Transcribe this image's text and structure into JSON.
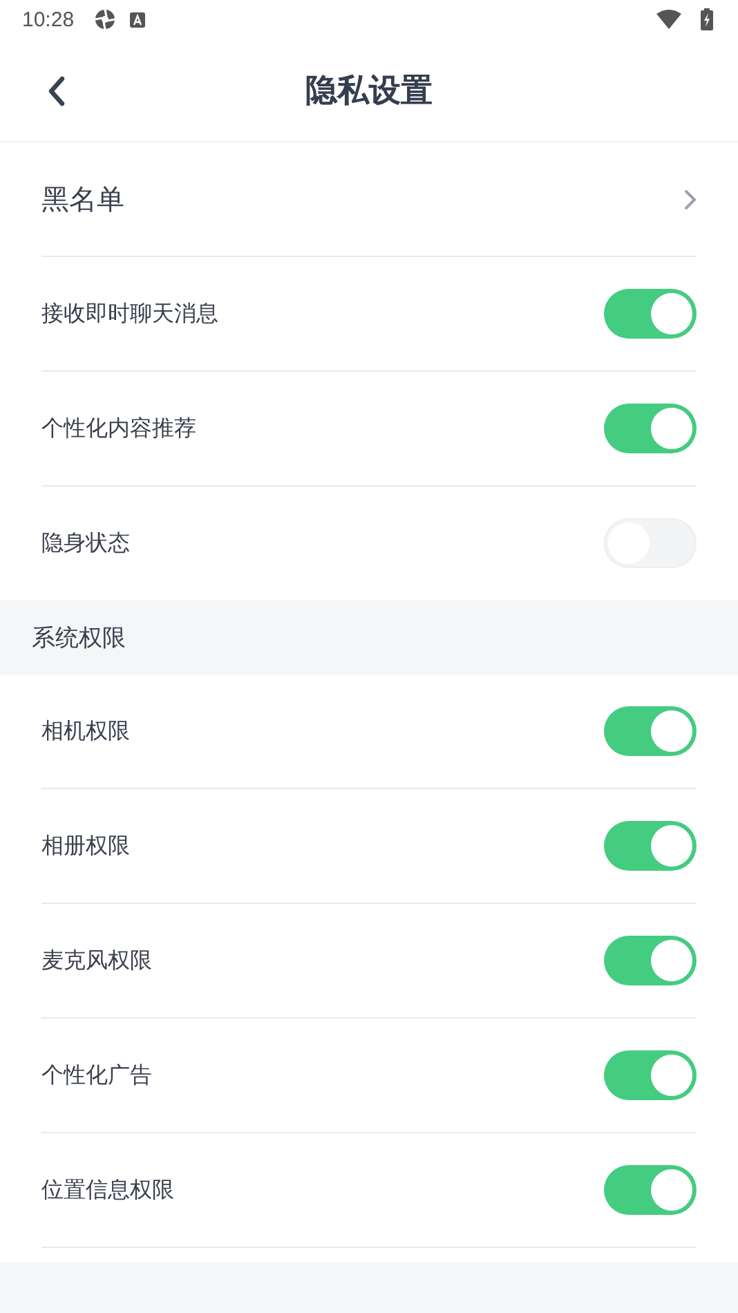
{
  "status_bar": {
    "time": "10:28"
  },
  "header": {
    "title": "隐私设置"
  },
  "groups": [
    {
      "items": [
        {
          "kind": "link",
          "label": "黑名单"
        },
        {
          "kind": "toggle",
          "label": "接收即时聊天消息",
          "on": true
        },
        {
          "kind": "toggle",
          "label": "个性化内容推荐",
          "on": true
        },
        {
          "kind": "toggle",
          "label": "隐身状态",
          "on": false
        }
      ]
    },
    {
      "title": "系统权限",
      "items": [
        {
          "kind": "toggle",
          "label": "相机权限",
          "on": true
        },
        {
          "kind": "toggle",
          "label": "相册权限",
          "on": true
        },
        {
          "kind": "toggle",
          "label": "麦克风权限",
          "on": true
        },
        {
          "kind": "toggle",
          "label": "个性化广告",
          "on": true
        },
        {
          "kind": "toggle",
          "label": "位置信息权限",
          "on": true
        }
      ]
    }
  ]
}
